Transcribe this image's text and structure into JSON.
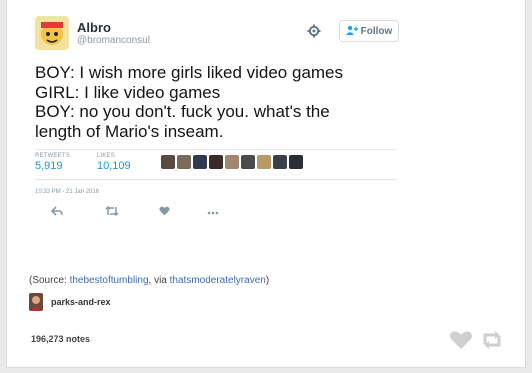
{
  "tweet": {
    "author_name": "Albro",
    "author_handle": "@bromanconsul",
    "follow_label": "Follow",
    "lines": [
      "BOY: I wish more girls liked video games",
      "GIRL: I like video games",
      "BOY: no you don't. fuck you. what's the",
      "length of Mario's inseam."
    ],
    "retweets_label": "RETWEETS",
    "retweets_value": "5,919",
    "likes_label": "LIKES",
    "likes_value": "10,109",
    "timestamp": "10:33 PM - 21 Jan 2016",
    "icons": {
      "reply": "reply-icon",
      "retweet": "retweet-icon",
      "like": "heart-icon",
      "more": "more-icon",
      "settings": "gear-icon",
      "follow": "add-user-icon"
    }
  },
  "source": {
    "prefix": "(Source: ",
    "source_link": "thebestoftumbling",
    "middle": ", via ",
    "via_link": "thatsmoderatelyraven",
    "suffix": ")"
  },
  "blog": {
    "name": "parks-and-rex"
  },
  "footer": {
    "notes": "196,273 notes",
    "icons": [
      "heart-icon",
      "reblog-icon"
    ]
  },
  "colors": {
    "link_blue": "#1b95e0",
    "source_link": "#3b6cb7",
    "muted": "#8899a6",
    "footer_icon": "#cfcfcf"
  }
}
